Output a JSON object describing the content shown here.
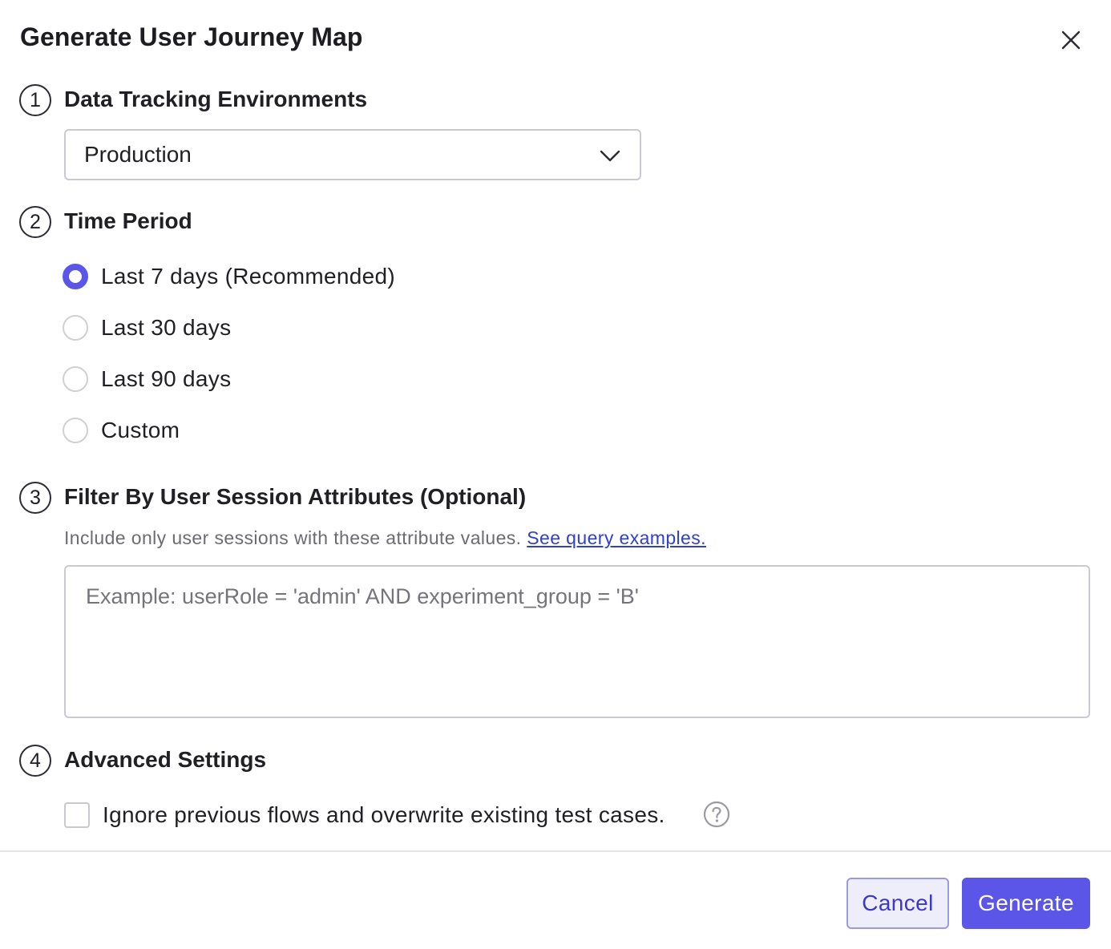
{
  "dialog": {
    "title": "Generate User Journey Map",
    "close_icon": "close-icon"
  },
  "sections": [
    {
      "number": "1",
      "title": "Data Tracking Environments"
    },
    {
      "number": "2",
      "title": "Time Period"
    },
    {
      "number": "3",
      "title": "Filter By User Session Attributes (Optional)"
    },
    {
      "number": "4",
      "title": "Advanced Settings"
    }
  ],
  "environment": {
    "selected": "Production",
    "icon": "chevron-down-icon"
  },
  "time_period": {
    "options": [
      {
        "label": "Last 7 days (Recommended)",
        "checked": true
      },
      {
        "label": "Last 30 days",
        "checked": false
      },
      {
        "label": "Last 90 days",
        "checked": false
      },
      {
        "label": "Custom",
        "checked": false
      }
    ]
  },
  "filter": {
    "help_text": "Include only user sessions with these attribute values.",
    "link_text": "See query examples.",
    "placeholder": "Example: userRole = 'admin' AND experiment_group = 'B'",
    "value": ""
  },
  "advanced": {
    "checkbox_label": "Ignore previous flows and overwrite existing test cases.",
    "checked": false,
    "help_icon": "question-circle-icon"
  },
  "footer": {
    "cancel_label": "Cancel",
    "generate_label": "Generate"
  },
  "colors": {
    "accent": "#5b55e8",
    "link": "#2f3fcf",
    "border": "#c9c9cf"
  }
}
